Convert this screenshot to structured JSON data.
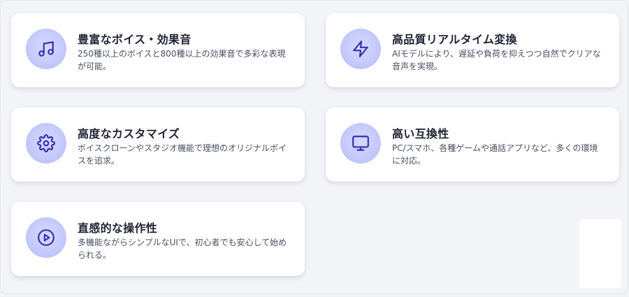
{
  "features": [
    {
      "icon": "music-note-icon",
      "title": "豊富なボイス・効果音",
      "description": "250種以上のボイスと800種以上の効果音で多彩な表現が可能。"
    },
    {
      "icon": "lightning-icon",
      "title": "高品質リアルタイム変換",
      "description": "AIモデルにより、遅延や負荷を抑えつつ自然でクリアな音声を実現。"
    },
    {
      "icon": "gear-icon",
      "title": "高度なカスタマイズ",
      "description": "ボイスクローンやスタジオ機能で理想のオリジナルボイスを追求。"
    },
    {
      "icon": "monitor-icon",
      "title": "高い互換性",
      "description": "PC/スマホ、各種ゲームや通話アプリなど、多くの環境に対応。"
    },
    {
      "icon": "play-circle-icon",
      "title": "直感的な操作性",
      "description": "多機能ながらシンプルなUIで、初心者でも安心して始められる。"
    }
  ],
  "colors": {
    "icon_stroke": "#3b2fb5",
    "icon_bg": "#c7ccfb",
    "card_bg": "#ffffff",
    "page_bg": "#f3f4f7"
  }
}
